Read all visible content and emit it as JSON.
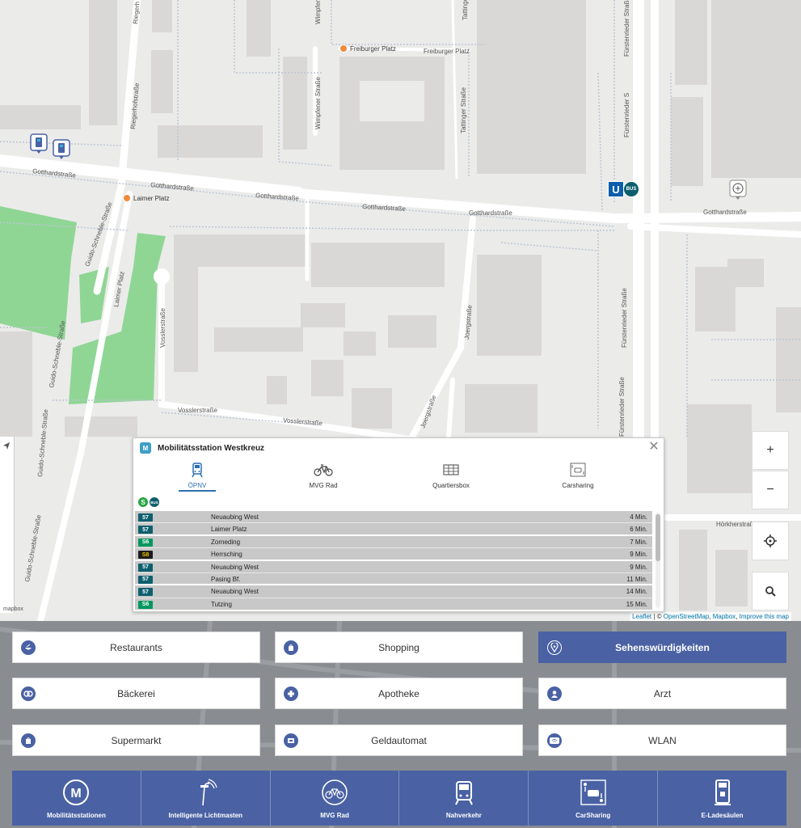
{
  "map": {
    "streets": {
      "gotthard_1": "Gotthardstraße",
      "gotthard_2": "Gotthardstraße",
      "gotthard_3": "Gotthardstraße",
      "gotthard_4": "Gotthardstraße",
      "gotthard_5": "Gotthardstraße",
      "gotthard_6": "Gotthardstraße",
      "freiburger": "Freiburger Platz",
      "wimpfener_1": "Wimpfener Straße",
      "wimpfener_2": "Wimpfener",
      "tattinger_1": "Tattinger Straße",
      "tattinger_2": "Tattinger",
      "riegerhof_1": "Riegerhofstraße",
      "riegerhof_2": "Riegerh",
      "fuerstenrieder_1": "Fürstenrieder Straße",
      "fuerstenrieder_2": "Fürstenrieder S",
      "fuerstenrieder_3": "Fürstenrieder Straße",
      "fuerstenrieder_4": "Fürstenrieder Straße",
      "laimer_platz_street": "Laimer Platz",
      "guido_1": "Guido-Schneble-Straße",
      "guido_2": "Guido-Schneble-Straße",
      "guido_3": "Guido-Schneble-Straße",
      "guido_4": "Guido-Schneble-Straße",
      "vossler_1": "Vosslerstraße",
      "vossler_2": "Vosslerstraße",
      "vossler_3": "Vosslerstraße",
      "joerg_1": "Joergstraße",
      "joerg_2": "Joergstraße",
      "horkher": "Hörkherstraße"
    },
    "pois": {
      "freiburger_platz": "Freiburger Platz",
      "laimer_platz": "Laimer Platz"
    },
    "ubahn_marker": "U",
    "bus_marker": "BUS",
    "controls": {
      "zoom_in": "+",
      "zoom_out": "−"
    },
    "attribution": {
      "leaflet": "Leaflet",
      "separator": " | © ",
      "osm": "OpenStreetMap",
      "comma": ", ",
      "mapbox": "Mapbox",
      "improve": "Improve this map"
    },
    "mapbox_logo": "mapbox"
  },
  "popup": {
    "title": "Mobilitätsstation Westkreuz",
    "logo_letter": "M",
    "tabs": [
      {
        "label": "ÖPNV"
      },
      {
        "label": "MVG Rad"
      },
      {
        "label": "Quartiersbox"
      },
      {
        "label": "Carsharing"
      }
    ],
    "modes": {
      "s": "S",
      "bus": "BUS"
    },
    "departures": [
      {
        "line": "57",
        "color": "#0e5f6e",
        "text_color": "#ffffff",
        "destination": "Neuaubing West",
        "time": "4 Min."
      },
      {
        "line": "57",
        "color": "#0e5f6e",
        "text_color": "#ffffff",
        "destination": "Laimer Platz",
        "time": "6 Min."
      },
      {
        "line": "S6",
        "color": "#00975f",
        "text_color": "#ffffff",
        "destination": "Zorneding",
        "time": "7 Min."
      },
      {
        "line": "S8",
        "color": "#1d1d1b",
        "text_color": "#f6c400",
        "destination": "Herrsching",
        "time": "9 Min."
      },
      {
        "line": "57",
        "color": "#0e5f6e",
        "text_color": "#ffffff",
        "destination": "Neuaubing West",
        "time": "9 Min."
      },
      {
        "line": "57",
        "color": "#0e5f6e",
        "text_color": "#ffffff",
        "destination": "Pasing Bf.",
        "time": "11 Min."
      },
      {
        "line": "57",
        "color": "#0e5f6e",
        "text_color": "#ffffff",
        "destination": "Neuaubing West",
        "time": "14 Min."
      },
      {
        "line": "S6",
        "color": "#00975f",
        "text_color": "#ffffff",
        "destination": "Tutzing",
        "time": "15 Min."
      }
    ]
  },
  "categories": [
    {
      "label": "Restaurants",
      "icon": "restaurant-icon",
      "active": false
    },
    {
      "label": "Shopping",
      "icon": "shopping-bag-icon",
      "active": false
    },
    {
      "label": "Sehenswürdigkeiten",
      "icon": "location-pin-icon",
      "active": true
    },
    {
      "label": "Bäckerei",
      "icon": "pretzel-icon",
      "active": false
    },
    {
      "label": "Apotheke",
      "icon": "pharmacy-cross-icon",
      "active": false
    },
    {
      "label": "Arzt",
      "icon": "doctor-icon",
      "active": false
    },
    {
      "label": "Supermarkt",
      "icon": "supermarket-bag-icon",
      "active": false
    },
    {
      "label": "Geldautomat",
      "icon": "atm-icon",
      "active": false
    },
    {
      "label": "WLAN",
      "icon": "wlan-icon",
      "active": false
    }
  ],
  "nav": [
    {
      "label": "Mobilitätsstationen",
      "icon": "mobility-station-icon"
    },
    {
      "label": "Intelligente Lichtmasten",
      "icon": "smart-lamp-icon"
    },
    {
      "label": "MVG Rad",
      "icon": "bicycle-icon"
    },
    {
      "label": "Nahverkehr",
      "icon": "tram-icon"
    },
    {
      "label": "CarSharing",
      "icon": "carsharing-icon"
    },
    {
      "label": "E-Ladesäulen",
      "icon": "charging-station-icon"
    }
  ],
  "colors": {
    "accent": "#4a62a4",
    "popup_tab_active": "#2a6fb0",
    "park": "#8fd694",
    "building": "#d9d7d5"
  }
}
